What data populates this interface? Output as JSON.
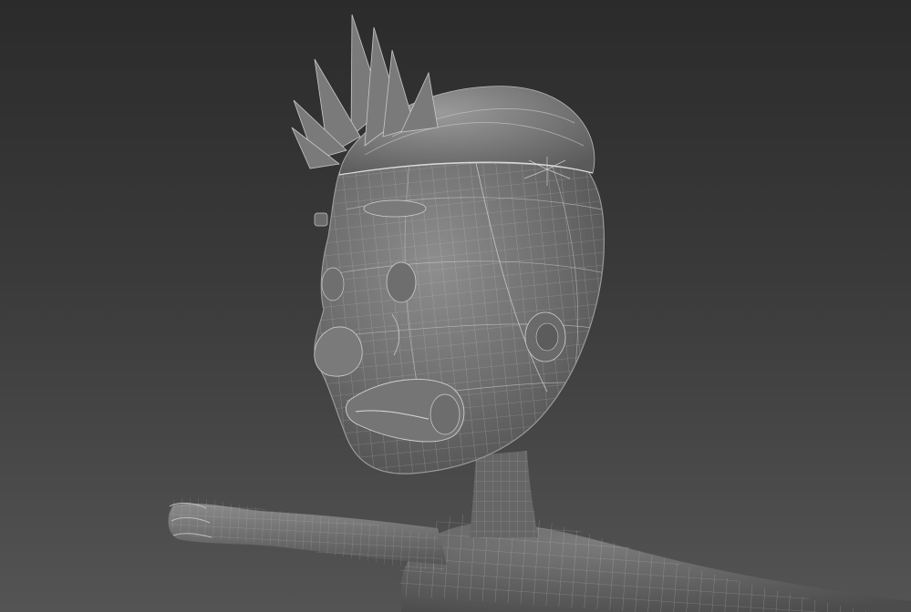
{
  "viewport": {
    "background_top": "#2b2b2b",
    "background_bottom": "#545454",
    "shading": "gray-clay-with-wireframe-overlay",
    "wire_color": "#c9c9c9"
  },
  "scene": {
    "subject": "cartoon-character-head-mesh",
    "parts": [
      "head",
      "hair-spikes",
      "eyebrow",
      "eye",
      "nose",
      "ear",
      "mouth",
      "neck",
      "left-arm",
      "hand",
      "torso"
    ]
  }
}
